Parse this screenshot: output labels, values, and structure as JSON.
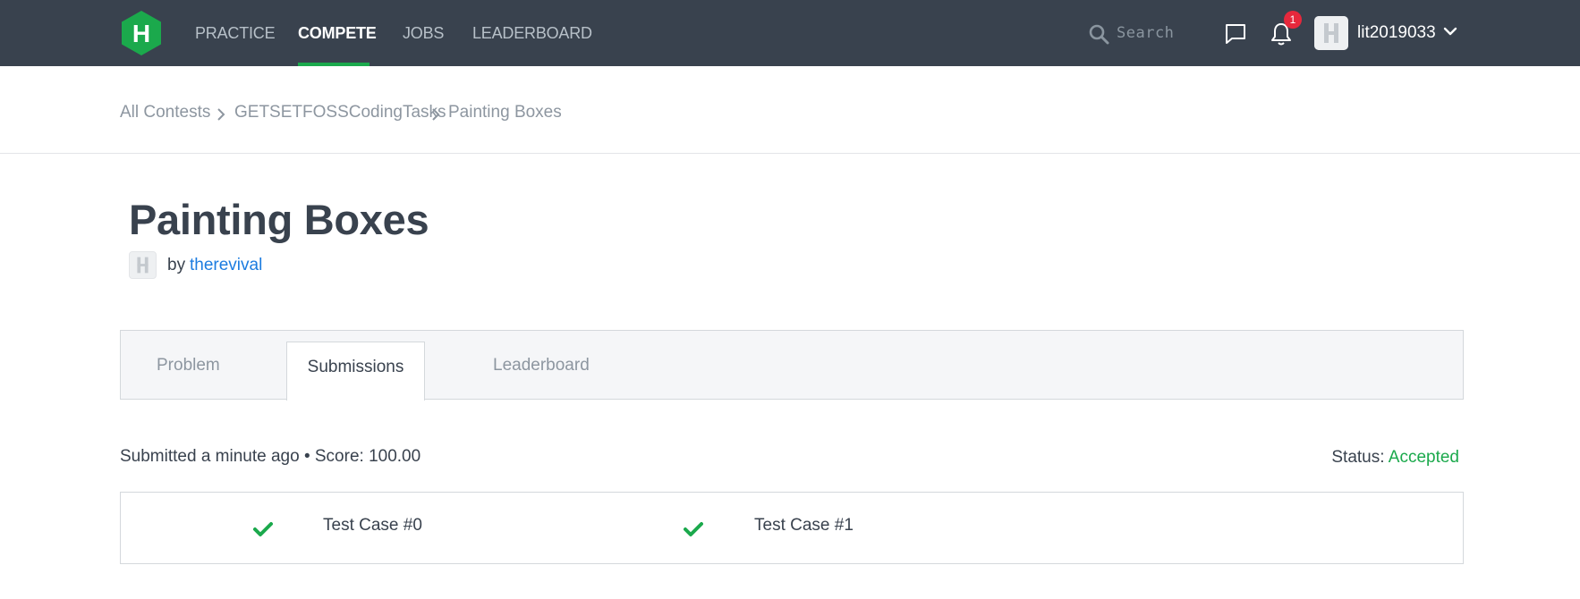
{
  "nav": {
    "logo_letter": "H",
    "items": [
      {
        "label": "PRACTICE"
      },
      {
        "label": "COMPETE"
      },
      {
        "label": "JOBS"
      },
      {
        "label": "LEADERBOARD"
      }
    ],
    "active_index": 1,
    "search_placeholder": "Search",
    "notification_count": "1",
    "username": "lit2019033",
    "icons": [
      "search-icon",
      "chat-icon",
      "bell-icon",
      "chevron-down-icon"
    ],
    "colors": {
      "bar": "#39424e",
      "accent": "#1ba94c",
      "badge": "#e6283c"
    }
  },
  "breadcrumb": {
    "items": [
      "All Contests",
      "GETSETFOSSCodingTasks",
      "Painting Boxes"
    ]
  },
  "challenge": {
    "title": "Painting Boxes",
    "by_label": "by",
    "author": "therevival"
  },
  "tabs": {
    "items": [
      {
        "label": "Problem"
      },
      {
        "label": "Submissions"
      },
      {
        "label": "Leaderboard"
      }
    ],
    "active_index": 1
  },
  "submission": {
    "summary": "Submitted a minute ago • Score: 100.00",
    "status_label": "Status:",
    "status_value": "Accepted",
    "status_color": "#1ba94c",
    "test_cases": [
      {
        "label": "Test Case #0",
        "passed": true
      },
      {
        "label": "Test Case #1",
        "passed": true
      }
    ]
  }
}
